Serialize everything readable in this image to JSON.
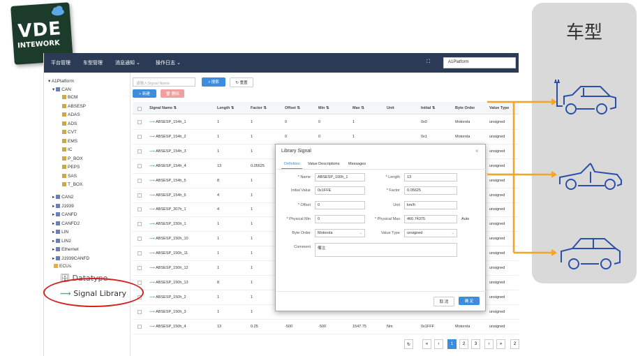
{
  "logo": {
    "line1": "VDE",
    "line2": "INTEWORK"
  },
  "topbar": {
    "nav": [
      "平台管理",
      "车型管理",
      "消息通知 ⌄",
      "操作日志 ⌄"
    ],
    "fullscreen": "⛶",
    "platform_select": "A1Platform"
  },
  "tree": {
    "root": "A1Platform",
    "can": "CAN",
    "can_children": [
      "BCM",
      "ABSESP",
      "ADAS",
      "ADS",
      "CVT",
      "EMS",
      "IC",
      "P_BOX",
      "PEPS",
      "SAS",
      "T_BOX"
    ],
    "siblings": [
      "CAN2",
      "J1939",
      "CANFD",
      "CANFD2",
      "LIN",
      "LIN2",
      "Ethernet",
      "J1939CANFD"
    ],
    "ecus": "ECUs",
    "datatype": "Datatype",
    "signal_library": "Signal Library"
  },
  "toolbar": {
    "search_placeholder": "请输入Signal Name",
    "search_btn": "搜索",
    "reset_btn": "重置",
    "add_btn": "+ 新建",
    "delete_btn": "删除"
  },
  "table": {
    "headers": [
      "Signal Name ⇅",
      "Length ⇅",
      "Factor ⇅",
      "Offset ⇅",
      "Min ⇅",
      "Max ⇅",
      "Unit",
      "Initial ⇅",
      "Byte Order",
      "Value Type"
    ],
    "rows": [
      [
        "ABSESP_154h_1",
        "1",
        "1",
        "0",
        "0",
        "1",
        "",
        "0x0",
        "Motorola",
        "unsigned"
      ],
      [
        "ABSESP_154h_2",
        "1",
        "1",
        "0",
        "0",
        "1",
        "",
        "0x1",
        "Motorola",
        "unsigned"
      ],
      [
        "ABSESP_154h_3",
        "1",
        "1",
        "",
        "",
        "",
        "",
        "",
        "",
        "unsigned"
      ],
      [
        "ABSESP_154h_4",
        "13",
        "0.05625",
        "",
        "",
        "",
        "",
        "",
        "",
        "unsigned"
      ],
      [
        "ABSESP_154h_5",
        "8",
        "1",
        "",
        "",
        "",
        "",
        "",
        "",
        "unsigned"
      ],
      [
        "ABSESP_154h_6",
        "4",
        "1",
        "",
        "",
        "",
        "",
        "",
        "",
        "unsigned"
      ],
      [
        "ABSESP_307h_1",
        "4",
        "1",
        "",
        "",
        "",
        "",
        "",
        "",
        "unsigned"
      ],
      [
        "ABSESP_150h_1",
        "1",
        "1",
        "",
        "",
        "",
        "",
        "",
        "",
        "unsigned"
      ],
      [
        "ABSESP_150h_10",
        "1",
        "1",
        "",
        "",
        "",
        "",
        "",
        "",
        "unsigned"
      ],
      [
        "ABSESP_150h_11",
        "1",
        "1",
        "",
        "",
        "",
        "",
        "",
        "",
        "unsigned"
      ],
      [
        "ABSESP_150h_12",
        "1",
        "1",
        "",
        "",
        "",
        "",
        "",
        "",
        "unsigned"
      ],
      [
        "ABSESP_150h_13",
        "8",
        "1",
        "",
        "",
        "",
        "",
        "",
        "",
        "unsigned"
      ],
      [
        "ABSESP_150h_2",
        "1",
        "1",
        "",
        "",
        "",
        "",
        "",
        "",
        "unsigned"
      ],
      [
        "ABSESP_150h_3",
        "1",
        "1",
        "",
        "",
        "",
        "",
        "",
        "",
        "unsigned"
      ],
      [
        "ABSESP_150h_4",
        "13",
        "0.25",
        "-500",
        "-500",
        "1547.75",
        "Nm",
        "0x1FFF",
        "Motorola",
        "unsigned"
      ]
    ]
  },
  "pager": {
    "prev_first": "«",
    "prev": "‹",
    "pages": [
      "1",
      "2",
      "3"
    ],
    "next": "›",
    "next_last": "»",
    "refresh": "↻",
    "goto": "2"
  },
  "dialog": {
    "title": "Library Signal",
    "close": "×",
    "tabs": [
      "Definition",
      "Value Descriptions",
      "Messages"
    ],
    "fields": {
      "name_label": "* Name",
      "name": "ABSESP_100h_1",
      "length_label": "* Length",
      "length": "13",
      "initial_label": "Initial Value",
      "initial": "0x1FFE",
      "factor_label": "* Factor",
      "factor": "0.05625",
      "offset_label": "* Offset",
      "offset": "0",
      "unit_label": "Unit",
      "unit": "km/h",
      "pmin_label": "* Physical Min",
      "pmin": "0",
      "pmax_label": "* Physical Max",
      "pmax": "460.74375",
      "auto": "Auto",
      "byte_order_label": "Byte Order",
      "byte_order": "Motorola",
      "value_type_label": "Value Type",
      "value_type": "unsigned",
      "comment_label": "Comment",
      "comment": "備注"
    },
    "cancel": "取 消",
    "ok": "确 定"
  },
  "panel": {
    "title": "车型"
  },
  "colors": {
    "topbar": "#2b3a55",
    "primary": "#3c8dde",
    "danger": "#f0a0a0",
    "arrow": "#f2a623",
    "car": "#2a4fa8"
  }
}
